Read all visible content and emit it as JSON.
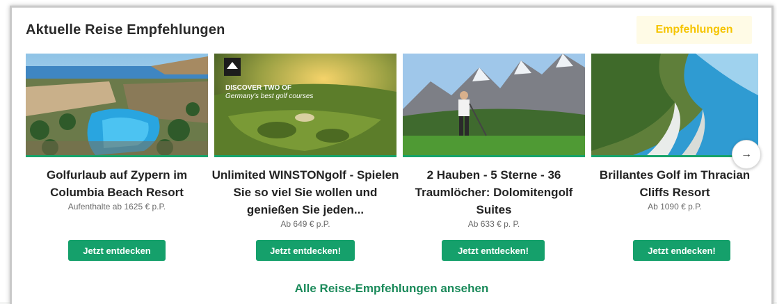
{
  "section": {
    "title": "Aktuelle Reise Empfehlungen",
    "recommendations_button": "Empfehlungen",
    "all_link": "Alle Reise-Empfehlungen ansehen",
    "next_arrow": "→"
  },
  "cards": [
    {
      "title": "Golfurlaub auf Zypern im Columbia Beach Resort",
      "price": "Aufenthalte ab 1625 € p.P.",
      "cta": "Jetzt entdecken",
      "image_icon": "resort-pool-photo"
    },
    {
      "title": "Unlimited WINSTONgolf - Spielen Sie so viel Sie wollen und genießen Sie jeden...",
      "price": "Ab 649 € p.P.",
      "cta": "Jetzt entdecken!",
      "image_icon": "golf-course-photo",
      "overlay_line1": "DISCOVER TWO OF",
      "overlay_line2": "Germany's best golf courses"
    },
    {
      "title": "2 Hauben - 5 Sterne - 36 Traumlöcher: Dolomitengolf Suites",
      "price": "Ab 633 € p. P.",
      "cta": "Jetzt entdecken!",
      "image_icon": "mountain-golfer-photo"
    },
    {
      "title": "Brillantes Golf im Thracian Cliffs Resort",
      "price": "Ab 1090 € p.P.",
      "cta": "Jetzt endecken!",
      "image_icon": "coastal-cliffs-photo"
    }
  ]
}
